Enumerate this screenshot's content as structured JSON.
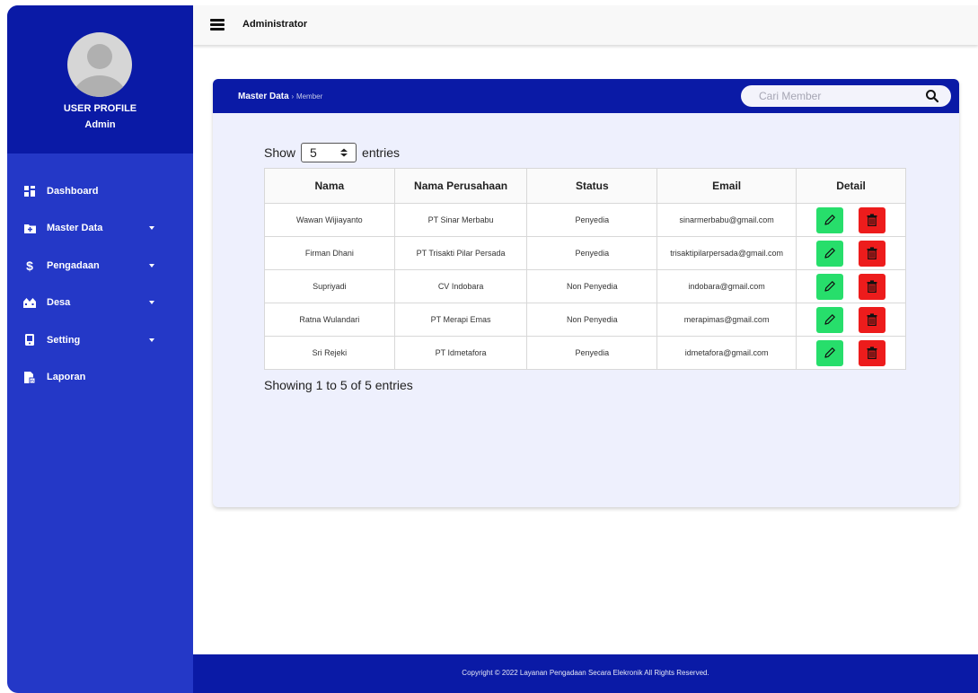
{
  "profile": {
    "role": "USER PROFILE",
    "name": "Admin"
  },
  "sidebar": {
    "items": [
      {
        "label": "Dashboard",
        "icon": "dashboard-icon",
        "caret": false
      },
      {
        "label": "Master Data",
        "icon": "folder-plus-icon",
        "caret": true
      },
      {
        "label": "Pengadaan",
        "icon": "dollar-icon",
        "caret": true
      },
      {
        "label": "Desa",
        "icon": "village-icon",
        "caret": true
      },
      {
        "label": "Setting",
        "icon": "device-icon",
        "caret": true
      },
      {
        "label": "Laporan",
        "icon": "report-icon",
        "caret": false
      }
    ]
  },
  "header": {
    "title": "Administrator"
  },
  "breadcrumb": {
    "main": "Master Data",
    "separator": "›",
    "current": "Member"
  },
  "search": {
    "placeholder": "Cari Member",
    "value": ""
  },
  "entries": {
    "show_label": "Show",
    "selected": "5",
    "suffix": "entries"
  },
  "table": {
    "columns": [
      "Nama",
      "Nama Perusahaan",
      "Status",
      "Email",
      "Detail"
    ],
    "rows": [
      {
        "nama": "Wawan Wijiayanto",
        "perusahaan": "PT Sinar Merbabu",
        "status": "Penyedia",
        "email": "sinarmerbabu@gmail.com"
      },
      {
        "nama": "Firman Dhani",
        "perusahaan": "PT Trisakti Pilar Persada",
        "status": "Penyedia",
        "email": "trisaktipilarpersada@gmail.com"
      },
      {
        "nama": "Supriyadi",
        "perusahaan": "CV Indobara",
        "status": "Non Penyedia",
        "email": "indobara@gmail.com"
      },
      {
        "nama": "Ratna Wulandari",
        "perusahaan": "PT Merapi Emas",
        "status": "Non Penyedia",
        "email": "merapimas@gmail.com"
      },
      {
        "nama": "Sri Rejeki",
        "perusahaan": "PT Idmetafora",
        "status": "Penyedia",
        "email": "idmetafora@gmail.com"
      }
    ]
  },
  "pagination": {
    "info": "Showing 1 to 5 of 5 entries"
  },
  "footer": {
    "copyright": "Copyright © 2022 Layanan Pengadaan Secara Elekronik All Rights Reserved."
  },
  "colors": {
    "primary_dark": "#0a1aa6",
    "sidebar": "#2438c7",
    "card_bg": "#eef0fd",
    "edit": "#27de6b",
    "delete": "#ed1c1c"
  }
}
